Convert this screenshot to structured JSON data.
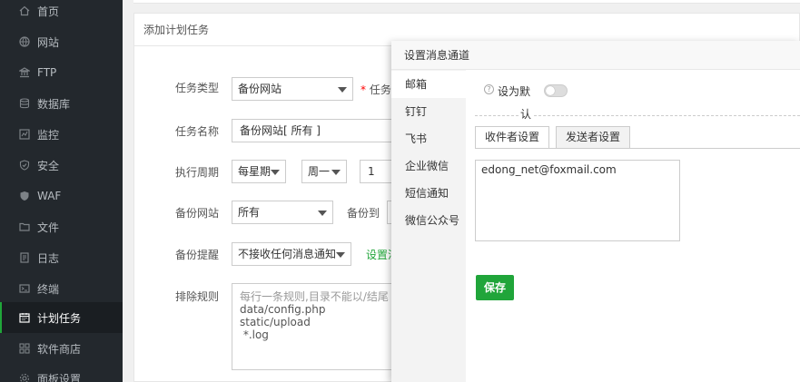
{
  "sidebar": {
    "items": [
      {
        "label": "首页",
        "icon": "home-icon"
      },
      {
        "label": "网站",
        "icon": "globe-icon"
      },
      {
        "label": "FTP",
        "icon": "ftp-icon"
      },
      {
        "label": "数据库",
        "icon": "database-icon"
      },
      {
        "label": "监控",
        "icon": "monitor-icon"
      },
      {
        "label": "安全",
        "icon": "shield-icon"
      },
      {
        "label": "WAF",
        "icon": "waf-shield-icon"
      },
      {
        "label": "文件",
        "icon": "folder-icon"
      },
      {
        "label": "日志",
        "icon": "log-icon"
      },
      {
        "label": "终端",
        "icon": "terminal-icon"
      },
      {
        "label": "计划任务",
        "icon": "calendar-icon"
      },
      {
        "label": "软件商店",
        "icon": "grid-icon"
      },
      {
        "label": "面板设置",
        "icon": "settings-icon"
      }
    ],
    "active_index": 10
  },
  "panel": {
    "title": "添加计划任务"
  },
  "form": {
    "task_type_label": "任务类型",
    "task_type_value": "备份网站",
    "task_type_note": "* 任务",
    "task_name_label": "任务名称",
    "task_name_value": "备份网站[ 所有 ]",
    "cycle_label": "执行周期",
    "cycle_value": "每星期",
    "weekday_value": "周一",
    "cycle_number": "1",
    "backup_site_label": "备份网站",
    "backup_site_value": "所有",
    "backup_to_label": "备份到",
    "reminder_label": "备份提醒",
    "reminder_value": "不接收任何消息通知",
    "reminder_link": "设置消",
    "exclude_label": "排除规则",
    "exclude_lines": [
      "每行一条规则,目录不能以/结尾",
      "data/config.php",
      "static/upload",
      " *.log"
    ]
  },
  "dialog": {
    "title": "设置消息通道",
    "channels": [
      "邮箱",
      "钉钉",
      "飞书",
      "企业微信",
      "短信通知",
      "微信公众号"
    ],
    "active_channel": 0,
    "default_label_1": "设为默",
    "default_label_2": "认",
    "default_toggle_on": false,
    "tabs": [
      "收件者设置",
      "发送者设置"
    ],
    "active_tab": 0,
    "recipients": "edong_net@foxmail.com",
    "save_label": "保存"
  },
  "colors": {
    "accent": "#20a53a",
    "sidebar_bg": "#23282d",
    "required": "#ff0000"
  }
}
